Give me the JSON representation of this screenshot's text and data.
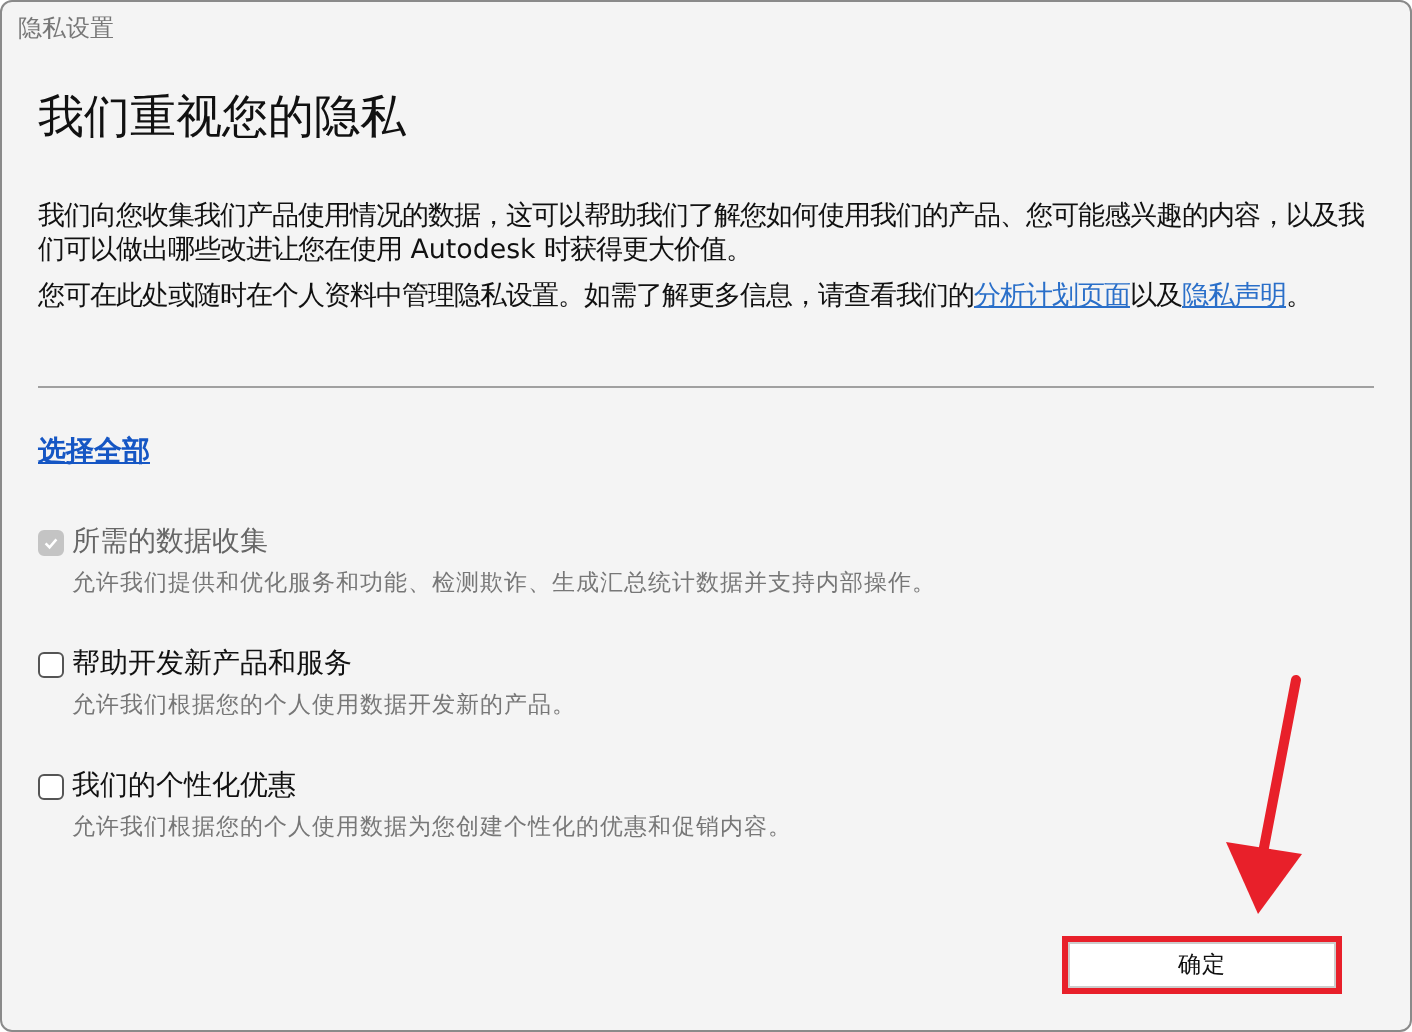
{
  "window": {
    "title": "隐私设置"
  },
  "heading": "我们重视您的隐私",
  "paragraphs": [
    [
      {
        "kind": "text",
        "text": "我们向您收集我们产品使用情况的数据，这可以帮助我们了解您如何使用我们的产品、您可能感兴趣的内容，以及我们可以做出哪些改进让您在使用 Autodesk 时获得更大价值。"
      }
    ],
    [
      {
        "kind": "text",
        "text": "您可在此处或随时在个人资料中管理隐私设置。如需了解更多信息，请查看我们的"
      },
      {
        "kind": "link",
        "text": "分析计划页面"
      },
      {
        "kind": "text",
        "text": "以及"
      },
      {
        "kind": "link",
        "text": "隐私声明"
      },
      {
        "kind": "text",
        "text": "。"
      }
    ]
  ],
  "select_all": "选择全部",
  "options": [
    {
      "label": "所需的数据收集",
      "description": "允许我们提供和优化服务和功能、检测欺诈、生成汇总统计数据并支持内部操作。",
      "checked": true,
      "disabled": true
    },
    {
      "label": "帮助开发新产品和服务",
      "description": "允许我们根据您的个人使用数据开发新的产品。",
      "checked": false,
      "disabled": false
    },
    {
      "label": "我们的个性化优惠",
      "description": "允许我们根据您的个人使用数据为您创建个性化的优惠和促销内容。",
      "checked": false,
      "disabled": false
    }
  ],
  "ok_button": "确定",
  "annotations": {
    "arrow": true,
    "highlight_button": true
  }
}
